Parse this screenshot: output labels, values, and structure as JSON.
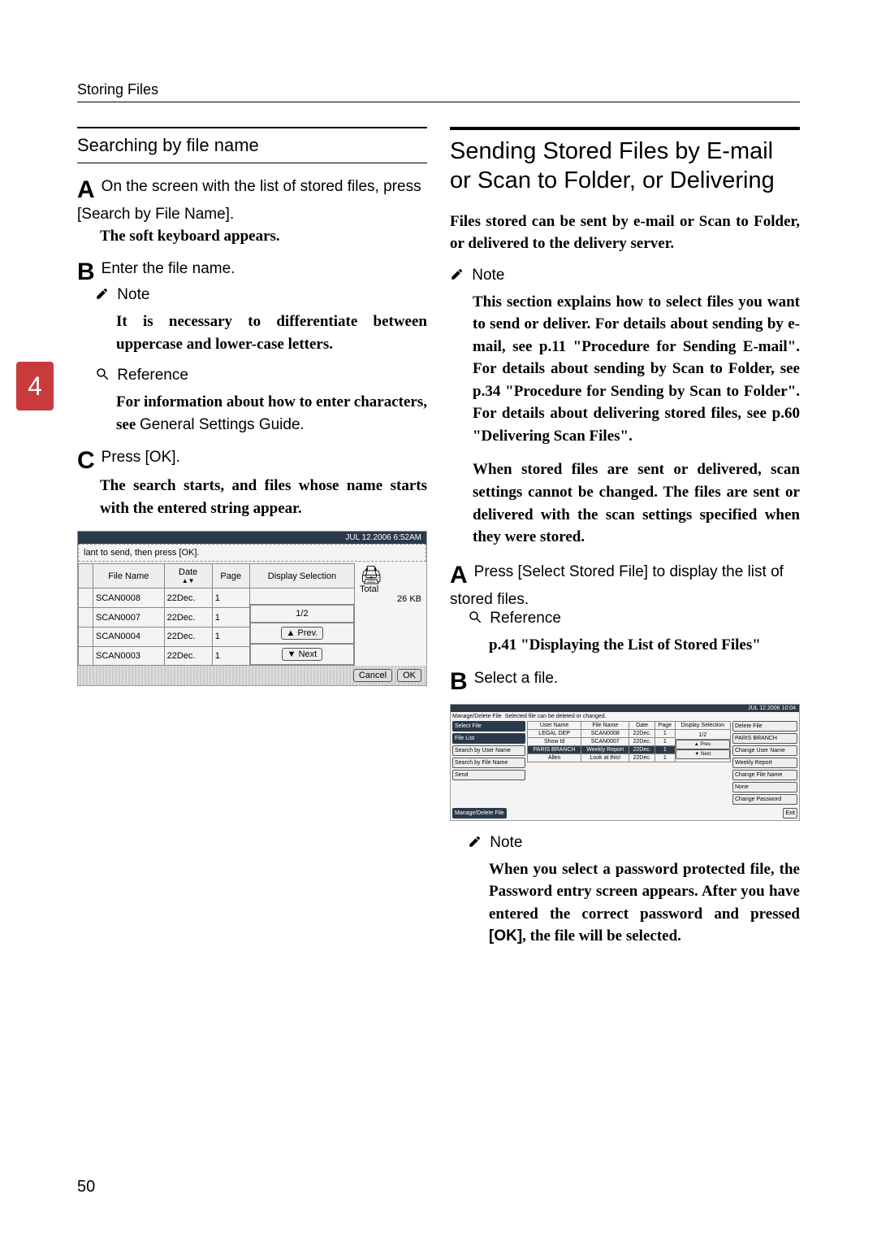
{
  "header": "Storing Files",
  "chapter_number": "4",
  "page_number": "50",
  "left": {
    "title": "Searching by file name",
    "stepA": {
      "letter": "A",
      "text_pre": "On the screen with the list of stored files, press ",
      "btn": "[Search by File Name]",
      "text_post": ".",
      "note": "The soft keyboard appears."
    },
    "stepB": {
      "letter": "B",
      "text": "Enter the file name.",
      "note_label": "Note",
      "note_body": "It is necessary to differentiate between uppercase and lower-case letters.",
      "ref_label": "Reference",
      "ref_body_pre": "For information about how to enter characters, see ",
      "ref_body_em": "General Settings Guide",
      "ref_body_post": "."
    },
    "stepC": {
      "letter": "C",
      "text_pre": "Press ",
      "btn": "[OK]",
      "text_post": ".",
      "body": "The search starts, and files whose name starts with the entered string appear."
    },
    "screenshot": {
      "banner": "JUL  12.2006  6:52AM",
      "instruction": "lant to send, then press [OK].",
      "cols": {
        "file": "File Name",
        "date": "Date",
        "page": "Page",
        "disp": "Display Selection"
      },
      "rows": [
        {
          "file": "SCAN0008",
          "date": "22Dec.",
          "page": "1"
        },
        {
          "file": "SCAN0007",
          "date": "22Dec.",
          "page": "1"
        },
        {
          "file": "SCAN0004",
          "date": "22Dec.",
          "page": "1"
        },
        {
          "file": "SCAN0003",
          "date": "22Dec.",
          "page": "1"
        }
      ],
      "page_indicator": "1/2",
      "prev": "▲ Prev.",
      "next": "▼ Next",
      "total_label": "Total",
      "total_value": "26 KB",
      "cancel": "Cancel"
    }
  },
  "right": {
    "title": "Sending Stored Files by E-mail or Scan to Folder, or Delivering",
    "intro": "Files stored can be sent by e-mail or Scan to Folder, or delivered to the delivery server.",
    "note_label": "Note",
    "note_body": "This section explains how to select files you want to send or deliver. For details about sending by e-mail, see p.11 \"Procedure for Sending E-mail\". For details about sending by Scan to Folder, see p.34 \"Procedure for Sending by Scan to Folder\". For details about delivering stored files, see p.60 \"Delivering Scan Files\".",
    "note_body2": "When stored files are sent or delivered, scan settings cannot be changed. The files are sent or delivered with the scan settings specified when they were stored.",
    "stepA": {
      "letter": "A",
      "text_pre": "Press ",
      "btn": "[Select Stored File]",
      "text_post": " to display the list of stored files.",
      "ref_label": "Reference",
      "ref_body": "p.41 \"Displaying the List of Stored Files\""
    },
    "stepB": {
      "letter": "B",
      "text": "Select a file.",
      "note_label": "Note",
      "note_body_pre": "When you select a password protected file, the Password entry screen appears. After you have entered the correct password and pressed ",
      "note_btn": "[OK]",
      "note_body_post": ", the file will be selected."
    },
    "screenshot": {
      "banner": "JUL  12.2006 10:04",
      "header_left": "Manage/Delete File",
      "header_right": "Selected file can be deleted or changed.",
      "left_buttons": [
        "Select File",
        "File List",
        "Search by User Name",
        "Search by File Name",
        "Send"
      ],
      "mid_cols": [
        "User Name",
        "File Name",
        "Date",
        "Page",
        "Display Selection"
      ],
      "rows": [
        {
          "user": "LEGAL DEP",
          "file": "SCAN0008",
          "date": "22Dec.",
          "page": "1"
        },
        {
          "user": "Show Id",
          "file": "SCAN0007",
          "date": "22Dec.",
          "page": "1"
        },
        {
          "user": "PARIS BRANCH",
          "file": "Weekly Report",
          "date": "22Dec.",
          "page": "1"
        },
        {
          "user": "Allen",
          "file": "Look at this!",
          "date": "22Dec.",
          "page": "1"
        }
      ],
      "page_indicator": "1/2",
      "prev": "▲ Prev.",
      "next": "▼ Next",
      "right_buttons": [
        "Delete File",
        "PARIS BRANCH",
        "Change User Name",
        "Weekly Report",
        "Change File Name",
        "None",
        "Change Password"
      ],
      "bottom_left": "Manage/Delete File",
      "bottom_right": "Exit"
    }
  }
}
